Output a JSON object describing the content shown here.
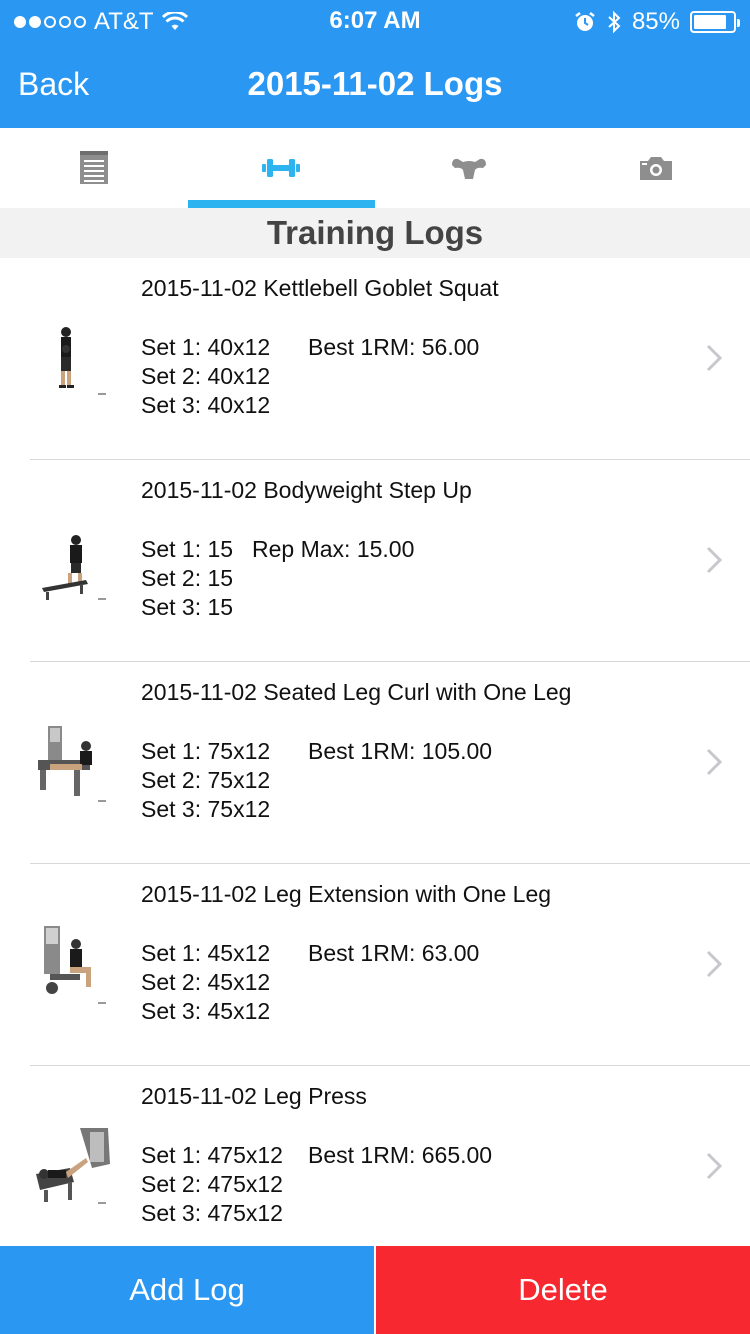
{
  "status_bar": {
    "carrier": "AT&T",
    "time": "6:07 AM",
    "battery_percent": "85%",
    "battery_level": 0.85,
    "signal_dots_filled": 2,
    "signal_dots_total": 5
  },
  "nav": {
    "back_label": "Back",
    "title": "2015-11-02 Logs"
  },
  "tabs": [
    {
      "icon": "notepad-icon",
      "active": false
    },
    {
      "icon": "dumbbell-icon",
      "active": true
    },
    {
      "icon": "muscle-icon",
      "active": false
    },
    {
      "icon": "camera-icon",
      "active": false
    }
  ],
  "section_title": "Training Logs",
  "logs": [
    {
      "title": "2015-11-02 Kettlebell Goblet Squat",
      "sets": [
        "Set 1: 40x12",
        "Set 2: 40x12",
        "Set 3: 40x12"
      ],
      "metric": "Best 1RM: 56.00",
      "thumb": "kettlebell-squat-thumbnail"
    },
    {
      "title": "2015-11-02 Bodyweight Step Up",
      "sets": [
        "Set 1: 15",
        "Set 2: 15",
        "Set 3: 15"
      ],
      "metric": "Rep Max: 15.00",
      "thumb": "step-up-thumbnail"
    },
    {
      "title": "2015-11-02 Seated Leg Curl with One Leg",
      "sets": [
        "Set 1: 75x12",
        "Set 2: 75x12",
        "Set 3: 75x12"
      ],
      "metric": "Best 1RM: 105.00",
      "thumb": "leg-curl-thumbnail"
    },
    {
      "title": "2015-11-02 Leg Extension with One Leg",
      "sets": [
        "Set 1: 45x12",
        "Set 2: 45x12",
        "Set 3: 45x12"
      ],
      "metric": "Best 1RM: 63.00",
      "thumb": "leg-extension-thumbnail"
    },
    {
      "title": "2015-11-02 Leg Press",
      "sets": [
        "Set 1: 475x12",
        "Set 2: 475x12",
        "Set 3: 475x12"
      ],
      "metric": "Best 1RM: 665.00",
      "thumb": "leg-press-thumbnail"
    }
  ],
  "buttons": {
    "add_label": "Add Log",
    "delete_label": "Delete"
  },
  "colors": {
    "header_blue": "#2A97F3",
    "tab_indicator": "#2DB3F0",
    "delete_red": "#F7282F",
    "icon_gray": "#8E8E8E"
  }
}
